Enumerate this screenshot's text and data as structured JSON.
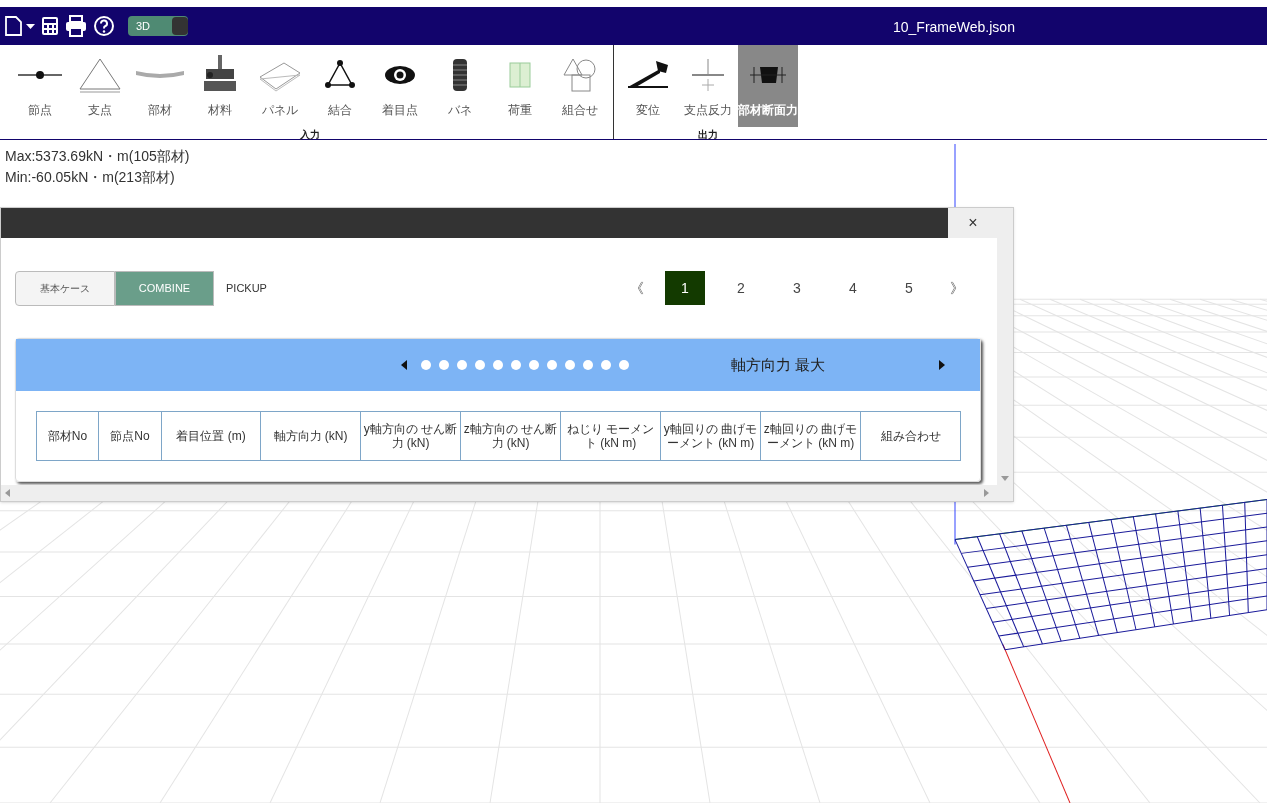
{
  "header": {
    "view_toggle": {
      "label": "3D",
      "on": true
    },
    "file_name": "10_FrameWeb.json"
  },
  "toolbar": {
    "groups": [
      {
        "label": "入力",
        "items": [
          {
            "kind": "node",
            "label": "節点",
            "selected": false
          },
          {
            "kind": "support",
            "label": "支点",
            "selected": false
          },
          {
            "kind": "member",
            "label": "部材",
            "selected": false
          },
          {
            "kind": "material",
            "label": "材料",
            "selected": false
          },
          {
            "kind": "panel",
            "label": "パネル",
            "selected": false
          },
          {
            "kind": "joint",
            "label": "結合",
            "selected": false
          },
          {
            "kind": "eye",
            "label": "着目点",
            "selected": false
          },
          {
            "kind": "spring",
            "label": "バネ",
            "selected": false
          },
          {
            "kind": "load",
            "label": "荷重",
            "selected": false
          },
          {
            "kind": "shapes",
            "label": "組合せ",
            "selected": false
          }
        ]
      },
      {
        "label": "出力",
        "items": [
          {
            "kind": "angle",
            "label": "変位",
            "selected": false
          },
          {
            "kind": "reaction",
            "label": "支点反力",
            "selected": false
          },
          {
            "kind": "section",
            "label": "部材断面力",
            "selected": true
          }
        ]
      }
    ]
  },
  "result_summary": [
    "Max:5373.69kN・m(105部材)",
    "Min:-60.05kN・m(213部材)"
  ],
  "dialog": {
    "close": "×",
    "case_tabs": [
      {
        "label": "基本ケース",
        "selected": false
      },
      {
        "label": "COMBINE",
        "selected": true
      },
      {
        "label": "PICKUP",
        "selected": false
      }
    ],
    "pagination": {
      "prev": "《",
      "next": "》",
      "pages": [
        {
          "label": "1",
          "selected": true
        },
        {
          "label": "2",
          "selected": false
        },
        {
          "label": "3",
          "selected": false
        },
        {
          "label": "4",
          "selected": false
        },
        {
          "label": "5",
          "selected": false
        }
      ]
    },
    "carousel": {
      "title": "軸方向力 最大",
      "dots": [
        {
          "selected": false
        },
        {
          "selected": false
        },
        {
          "selected": false
        },
        {
          "selected": false
        },
        {
          "selected": false
        },
        {
          "selected": false
        },
        {
          "selected": false
        },
        {
          "selected": false
        },
        {
          "selected": false
        },
        {
          "selected": false
        },
        {
          "selected": false
        },
        {
          "selected": false
        }
      ]
    },
    "table": {
      "columns": [
        "部材No",
        "節点No",
        "着目位置 (m)",
        "軸方向力 (kN)",
        "y軸方向の せん断力 (kN)",
        "z軸方向の せん断力 (kN)",
        "ねじり モーメント (kN m)",
        "y軸回りの 曲げモーメント (kN m)",
        "z軸回りの 曲げモーメント (kN m)",
        "組み合わせ"
      ]
    }
  }
}
